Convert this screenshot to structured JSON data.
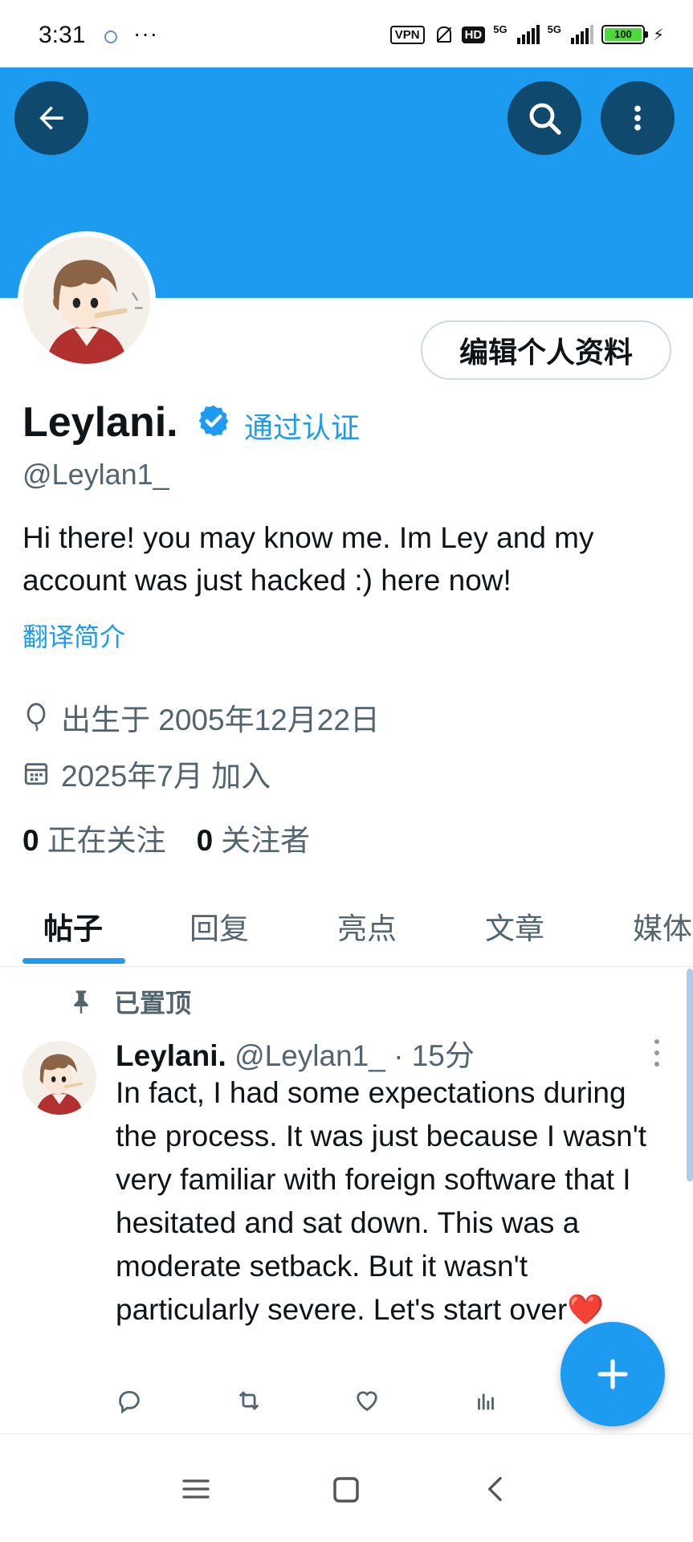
{
  "status_bar": {
    "time": "3:31",
    "more": "···",
    "vpn": "VPN",
    "hd": "HD",
    "network": "5G",
    "battery": "100",
    "charging": "⚡"
  },
  "banner": {
    "color": "#1d9bf0"
  },
  "profile": {
    "edit_button": "编辑个人资料",
    "name": "Leylani.",
    "verified_label": "通过认证",
    "handle": "@Leylan1_",
    "bio": "Hi there! you may know me. Im Ley and my account was just hacked :) here now!",
    "translate_bio": "翻译简介",
    "birth": "出生于 2005年12月22日",
    "joined": "2025年7月 加入",
    "following_count": "0",
    "following_label": "正在关注",
    "followers_count": "0",
    "followers_label": "关注者"
  },
  "tabs": [
    "帖子",
    "回复",
    "亮点",
    "文章",
    "媒体"
  ],
  "post": {
    "pinned_label": "已置顶",
    "author_name": "Leylani.",
    "author_handle": "@Leylan1_",
    "time": "· 15分",
    "text": "In fact, I had some expectations during the process. It was just because I wasn't very familiar with foreign software that I hesitated and sat down. This was a moderate setback. But it wasn't particularly severe. Let's start over❤️"
  },
  "icons": {
    "back": "arrow-left-icon",
    "search": "search-icon",
    "more": "more-vertical-icon",
    "verified": "verified-badge-icon",
    "birth": "balloon-icon",
    "calendar": "calendar-icon",
    "pin": "pin-icon",
    "reply": "reply-icon",
    "repost": "repost-icon",
    "like": "heart-icon",
    "views": "views-icon",
    "compose": "plus-icon"
  },
  "colors": {
    "accent": "#1d9bf0",
    "banner_button": "#0f4a6e",
    "secondary_text": "#536471",
    "primary_text": "#0f1419"
  }
}
